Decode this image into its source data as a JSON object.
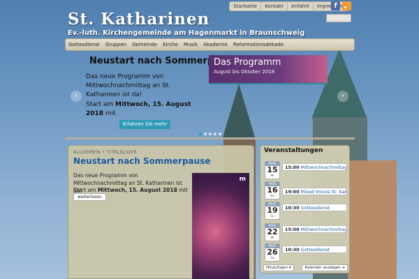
{
  "header": {
    "title": "St. Katharinen",
    "subtitle": "Ev.-luth. Kirchengemeinde am Hagenmarkt in Braunschweig"
  },
  "topnav": [
    "Startseite",
    "Kontakt",
    "Anfahrt",
    "Impressum"
  ],
  "social": {
    "facebook_icon": "facebook-icon",
    "rss_icon": "rss-icon"
  },
  "mainnav": [
    "Gottesdienst",
    "Gruppen",
    "Gemeinde",
    "Kirche",
    "Musik",
    "Akademie",
    "Reformationsdekade"
  ],
  "slider": {
    "title": "Neustart nach Sommerpause",
    "text": "Das neue Programm von Mittwochnachmittag an St. Katharinen ist da!",
    "date_prefix": "Start am ",
    "date_bold": "Mittwoch, 15. August 2018",
    "date_suffix": " mit",
    "button": "Erfahren Sie mehr",
    "promo_line1": "Das Programm",
    "promo_line2": "August bis Oktober 2018",
    "prev": "‹",
    "next": "›"
  },
  "article": {
    "categories": "ALLGEMEIN • TITELSLIDER",
    "title": "Neustart nach Sommerpause",
    "text": "Das neue Programm von Mittwochnachmittag an St. Katharinen ist da!",
    "date_prefix": "Start am ",
    "date_bold": "Mittwoch, 15. August 2018",
    "date_suffix": " mit",
    "more": "weiterlesen",
    "image_mark": "m"
  },
  "events": {
    "heading": "Veranstaltungen",
    "items": [
      {
        "month": "AUG",
        "day": "15",
        "weekday": "Mi",
        "time": "15:00",
        "name": "Mittwochnachmittag"
      },
      {
        "month": "AUG",
        "day": "16",
        "weekday": "Do",
        "time": "19:00",
        "name": "Mixed Voices St. Kath."
      },
      {
        "month": "AUG",
        "day": "19",
        "weekday": "So",
        "time": "10:30",
        "name": "Gottesdienst"
      },
      {
        "month": "AUG",
        "day": "22",
        "weekday": "Mi",
        "time": "15:00",
        "name": "Mittwochnachmittag"
      },
      {
        "month": "AUG",
        "day": "26",
        "weekday": "So",
        "time": "10:30",
        "name": "Gottesdienst"
      }
    ],
    "add_label": "Hinzufügen ▾",
    "show_label": "Kalender anzeigen ➔"
  }
}
